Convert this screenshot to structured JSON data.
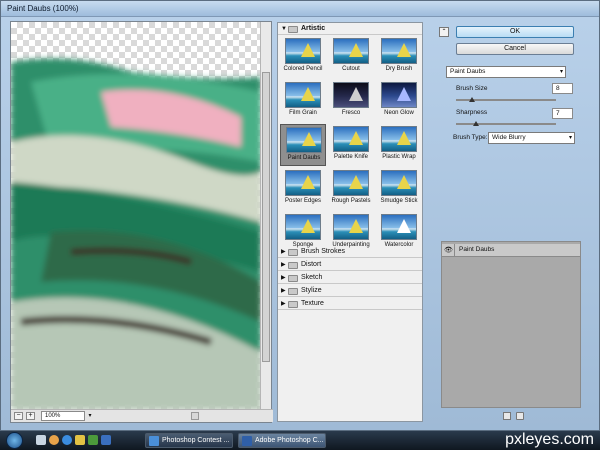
{
  "window": {
    "title": "Paint Daubs (100%)"
  },
  "preview": {
    "zoom": "100%",
    "zoom_in": "+",
    "zoom_out": "−"
  },
  "gallery": {
    "open_category": "Artistic",
    "filters": [
      "Colored Pencil",
      "Cutout",
      "Dry Brush",
      "Film Grain",
      "Fresco",
      "Neon Glow",
      "Paint Daubs",
      "Palette Knife",
      "Plastic Wrap",
      "Poster Edges",
      "Rough Pastels",
      "Smudge Stick",
      "Sponge",
      "Underpainting",
      "Watercolor"
    ],
    "selected_filter": "Paint Daubs",
    "categories": [
      "Brush Strokes",
      "Distort",
      "Sketch",
      "Stylize",
      "Texture"
    ]
  },
  "settings": {
    "ok_label": "OK",
    "cancel_label": "Cancel",
    "filter_select": "Paint Daubs",
    "brush_size_label": "Brush Size",
    "brush_size_value": "8",
    "sharpness_label": "Sharpness",
    "sharpness_value": "7",
    "brush_type_label": "Brush Type:",
    "brush_type_value": "Wide Blurry"
  },
  "layers": {
    "items": [
      {
        "name": "Paint Daubs"
      }
    ]
  },
  "taskbar": {
    "tasks": [
      {
        "label": "Photoshop Contest ..."
      },
      {
        "label": "Adobe Photoshop C..."
      }
    ]
  },
  "watermark": "pxleyes.com",
  "icons": {
    "expand": "triangle-right-icon",
    "collapse": "triangle-down-icon",
    "folder": "folder-icon",
    "eye": "eye-icon",
    "new_layer": "new-layer-icon",
    "delete_layer": "trash-icon"
  }
}
